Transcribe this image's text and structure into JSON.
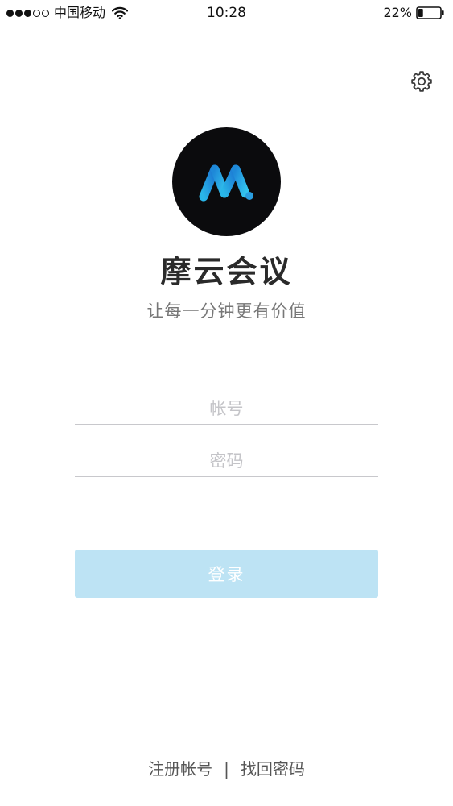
{
  "status_bar": {
    "signal_full": 3,
    "signal_total": 5,
    "carrier": "中国移动",
    "time": "10:28",
    "battery_percent": "22%",
    "battery_level": 0.22,
    "icons": [
      "signal-dots-icon",
      "wifi-icon",
      "battery-icon"
    ]
  },
  "settings": {
    "icon": "gear-icon"
  },
  "logo": {
    "icon": "logo-m-icon",
    "colors": {
      "background": "#0b0b0d",
      "gradient_start": "#29b6e8",
      "gradient_end": "#1a6fd0"
    }
  },
  "app_name": "摩云会议",
  "slogan": "让每一分钟更有价值",
  "form": {
    "account_placeholder": "帐号",
    "account_value": "",
    "password_placeholder": "密码",
    "password_value": ""
  },
  "login_button": {
    "label": "登录",
    "color": "#bde3f4"
  },
  "footer": {
    "register_label": "注册帐号",
    "separator": "|",
    "recover_label": "找回密码"
  }
}
